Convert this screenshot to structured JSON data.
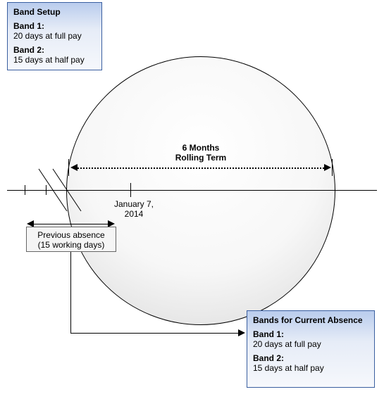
{
  "setupBox": {
    "title": "Band Setup",
    "band1_label": "Band 1:",
    "band1_text": "20 days at full pay",
    "band2_label": "Band 2:",
    "band2_text": "15 days at half pay"
  },
  "term": {
    "line1": "6 Months",
    "line2": "Rolling Term"
  },
  "date": {
    "line1": "January 7,",
    "line2": "2014"
  },
  "prevAbsence": {
    "line1": "Previous absence",
    "line2": "(15 working days)"
  },
  "currentBox": {
    "title": "Bands for Current Absence",
    "band1_label": "Band 1:",
    "band1_text": "20 days at full pay",
    "band2_label": "Band 2:",
    "band2_text": "15 days at half pay"
  }
}
